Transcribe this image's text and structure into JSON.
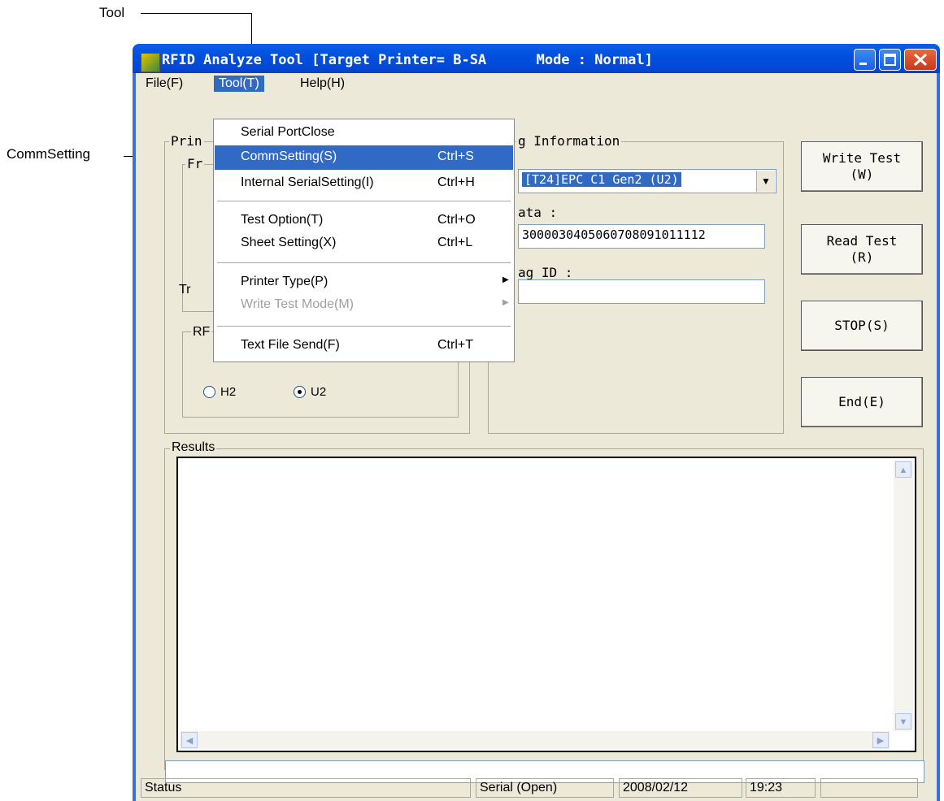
{
  "callouts": {
    "tool": "Tool",
    "commsetting": "CommSetting"
  },
  "window": {
    "title": "RFID Analyze Tool [Target Printer= B-SA",
    "mode": "Mode : Normal]"
  },
  "menubar": [
    {
      "label": "File(F)"
    },
    {
      "label": "Tool(T)"
    },
    {
      "label": "Help(H)"
    }
  ],
  "tool_menu": {
    "items": [
      {
        "label": "Serial PortClose",
        "shortcut": ""
      },
      {
        "label": "CommSetting(S)",
        "shortcut": "Ctrl+S"
      },
      {
        "label": "Internal SerialSetting(I)",
        "shortcut": "Ctrl+H"
      },
      {
        "label": "Test Option(T)",
        "shortcut": "Ctrl+O"
      },
      {
        "label": "Sheet Setting(X)",
        "shortcut": "Ctrl+L"
      },
      {
        "label": "Printer Type(P)",
        "shortcut": ""
      },
      {
        "label": "Write Test Mode(M)",
        "shortcut": ""
      },
      {
        "label": "Text File Send(F)",
        "shortcut": "Ctrl+T"
      }
    ]
  },
  "left_panel": {
    "group_label": "Prin",
    "sub_label": "Fr",
    "tr_label": "Tr",
    "rfid_label": "RF"
  },
  "rfid_radios": [
    {
      "label": "H2",
      "checked": false
    },
    {
      "label": "U2",
      "checked": true
    }
  ],
  "tag_info": {
    "group_label": "g Information",
    "tag_type": "[T24]EPC C1 Gen2 (U2)",
    "data_label": "ata :",
    "data_value": "3000030405060708091011112",
    "tag_id_label": "ag ID :",
    "tag_id_value": ""
  },
  "buttons": {
    "write": "Write Test\n(W)",
    "read": "Read Test\n(R)",
    "stop": "STOP(S)",
    "end": "End(E)"
  },
  "results_label": "Results",
  "statusbar": {
    "status": "Status",
    "comm": "Serial (Open)",
    "date": "2008/02/12",
    "time": "19:23"
  }
}
